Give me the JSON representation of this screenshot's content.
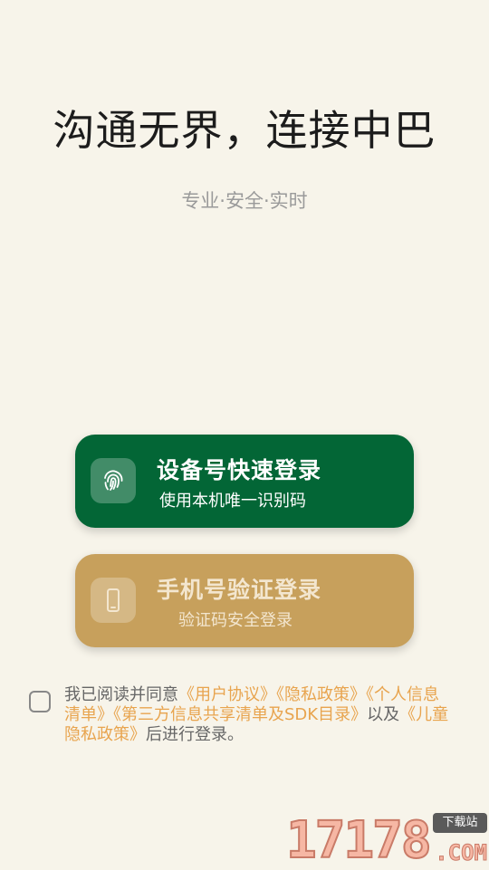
{
  "header": {
    "headline": "沟通无界，连接中巴",
    "tagline": "专业·安全·实时"
  },
  "device_login": {
    "title": "设备号快速登录",
    "subtitle": "使用本机唯一识别码",
    "icon": "fingerprint-icon",
    "color": "#036636"
  },
  "phone_login": {
    "title": "手机号验证登录",
    "subtitle": "验证码安全登录",
    "icon": "smartphone-icon",
    "color": "#c7a05c"
  },
  "agreement": {
    "prefix": "我已阅读并同意",
    "user_agreement": "《用户协议》",
    "privacy_policy": "《隐私政策》",
    "personal_info_list": "《个人信息清单》",
    "third_party_list": "《第三方信息共享清单及SDK目录》",
    "conjunction": "以及",
    "child_privacy": "《儿童隐私政策》",
    "suffix": "后进行登录。",
    "link_color": "#e8a44e"
  },
  "watermark": {
    "digits": "17178",
    "badge": "下载站",
    "domain": ".COM"
  }
}
